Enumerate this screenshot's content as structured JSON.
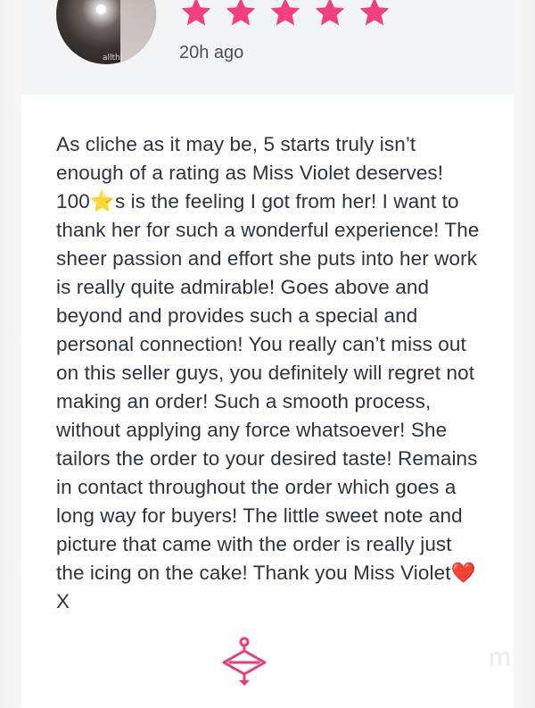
{
  "review": {
    "rating": 5,
    "rating_max": 5,
    "time_ago": "20h ago",
    "avatar_caption": "allthi",
    "text": "As cliche as it may be, 5 starts truly isn’t enough of a rating as Miss Violet deserves! 100⭐s is the feeling I got from her! I want to thank her for such a wonderful experience! The sheer passion and effort she puts into her work is really quite admirable! Goes above and beyond and provides such a special and personal connection! You really can’t miss out on this seller guys, you definitely will regret not making an order! Such a smooth process, without applying any force whatsoever! She tailors the order to your desired taste! Remains in contact throughout the order which goes a long way for buyers! The little sweet note and picture that came with the order is really just the icing on the cake! Thank you Miss Violet❤️X"
  },
  "colors": {
    "star": "#f33f7d",
    "logo": "#ee3b7c",
    "header_bg": "#f3f4f6",
    "text": "#2e3340"
  },
  "icons": {
    "star": "star-icon",
    "logo": "hanger-logo-icon"
  },
  "watermark": "m"
}
